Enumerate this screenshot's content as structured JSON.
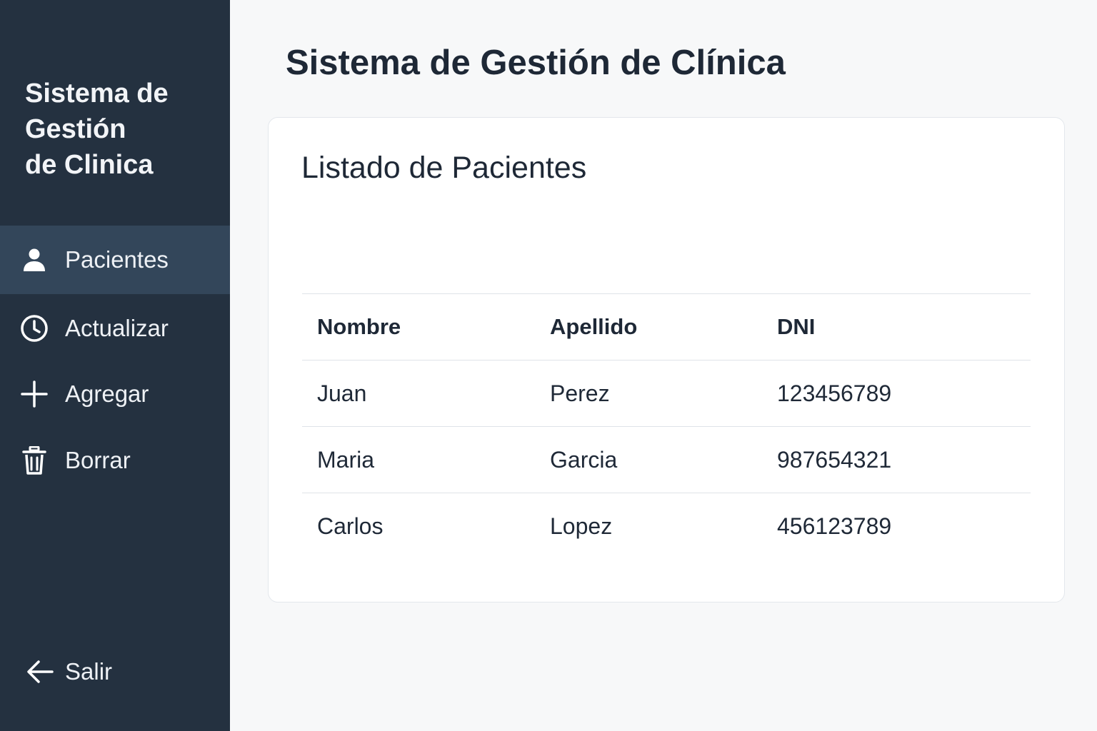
{
  "sidebar": {
    "brand_lines": [
      "Sistema de",
      "Gestión",
      "de Clinica"
    ],
    "items": [
      {
        "label": "Pacientes",
        "icon": "user-icon",
        "active": true
      },
      {
        "label": "Actualizar",
        "icon": "clock-icon",
        "active": false
      },
      {
        "label": "Agregar",
        "icon": "plus-icon",
        "active": false
      },
      {
        "label": "Borrar",
        "icon": "trash-icon",
        "active": false
      }
    ],
    "logout": {
      "label": "Salir",
      "icon": "arrow-left-icon"
    }
  },
  "main": {
    "title": "Sistema de Gestión de Clínica",
    "card": {
      "title": "Listado de Pacientes",
      "table": {
        "headers": [
          "Nombre",
          "Apellido",
          "DNI"
        ],
        "rows": [
          [
            "Juan",
            "Perez",
            "123456789"
          ],
          [
            "Maria",
            "Garcia",
            "987654321"
          ],
          [
            "Carlos",
            "Lopez",
            "456123789"
          ]
        ]
      }
    }
  },
  "colors": {
    "sidebar_bg": "#243140",
    "sidebar_active_bg": "#33465a",
    "page_bg": "#f7f8f9",
    "card_bg": "#ffffff",
    "text_dark": "#1e2836"
  }
}
